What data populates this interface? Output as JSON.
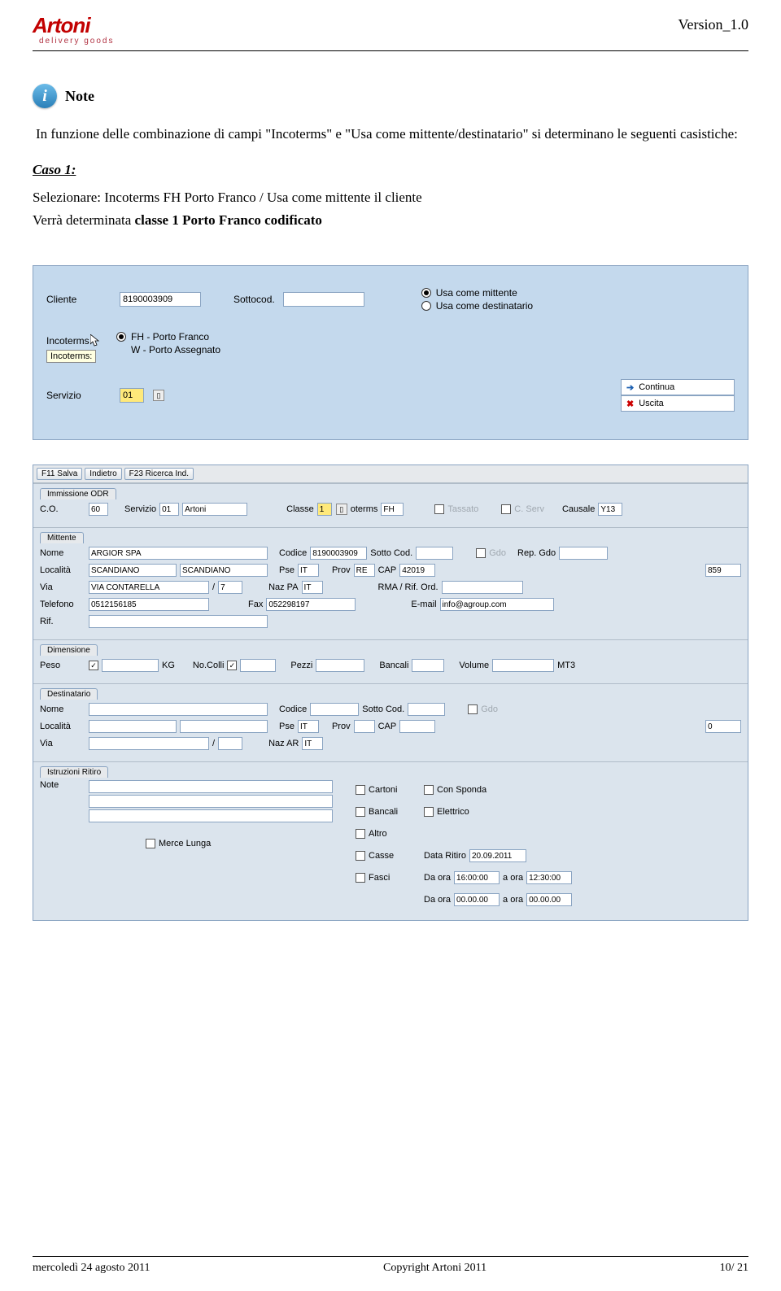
{
  "header": {
    "logo": "Artoni",
    "logo_sub": "delivery goods",
    "version": "Version_1.0"
  },
  "note": {
    "title": "Note",
    "body": "In funzione delle combinazione di campi \"Incoterms\" e \"Usa come mittente/destinatario\" si determinano le seguenti casistiche:"
  },
  "case1": {
    "label": "Caso 1:",
    "line1": "Selezionare: Incoterms FH Porto Franco /  Usa come mittente il cliente",
    "line2_prefix": "Verrà determinata ",
    "line2_bold": "classe 1 Porto Franco codificato"
  },
  "sap": {
    "cliente_label": "Cliente",
    "cliente_value": "8190003909",
    "sottocod_label": "Sottocod.",
    "sottocod_value": "",
    "usa_mittente": "Usa come mittente",
    "usa_destinatario": "Usa come destinatario",
    "incoterms_label": "Incoterms",
    "incoterms_tooltip": "Incoterms:",
    "opt_fh": "FH - Porto Franco",
    "opt_w": "W - Porto Assegnato",
    "servizio_label": "Servizio",
    "servizio_value": "01",
    "btn_continua": "Continua",
    "btn_uscita": "Uscita"
  },
  "form": {
    "toolbar": {
      "b1": "F11 Salva",
      "b2": "Indietro",
      "b3": "F23 Ricerca Ind."
    },
    "odr": {
      "tab": "Immissione ODR",
      "co_label": "C.O.",
      "co": "60",
      "serv_label": "Servizio",
      "serv": "01",
      "serv_txt": "Artoni",
      "classe_label": "Classe",
      "classe": "1",
      "oterms_label": "oterms",
      "oterms": "FH",
      "tassato": "Tassato",
      "cserv": "C. Serv",
      "causale_label": "Causale",
      "causale": "Y13"
    },
    "mittente": {
      "tab": "Mittente",
      "nome_label": "Nome",
      "nome": "ARGIOR SPA",
      "codice_label": "Codice",
      "codice": "8190003909",
      "sotto_label": "Sotto Cod.",
      "sotto": "",
      "gdo": "Gdo",
      "rep_label": "Rep. Gdo",
      "loc_label": "Località",
      "loc1": "SCANDIANO",
      "loc2": "SCANDIANO",
      "pse_label": "Pse",
      "pse": "IT",
      "prov_label": "Prov",
      "prov": "RE",
      "cap_label": "CAP",
      "cap": "42019",
      "extra": "859",
      "via_label": "Via",
      "via": "VIA CONTARELLA",
      "via_n": "7",
      "nazpa_label": "Naz PA",
      "nazpa": "IT",
      "rma_label": "RMA / Rif. Ord.",
      "rma": "",
      "tel_label": "Telefono",
      "tel": "0512156185",
      "fax_label": "Fax",
      "fax": "052298197",
      "email_label": "E-mail",
      "email": "info@agroup.com",
      "rif_label": "Rif.",
      "rif": ""
    },
    "dim": {
      "tab": "Dimensione",
      "peso_label": "Peso",
      "peso": "",
      "kg": "KG",
      "colli_label": "No.Colli",
      "colli": "",
      "pezzi_label": "Pezzi",
      "pezzi": "",
      "bancali_label": "Bancali",
      "bancali": "",
      "volume_label": "Volume",
      "volume": "",
      "mt3": "MT3"
    },
    "dest": {
      "tab": "Destinatario",
      "nome_label": "Nome",
      "codice_label": "Codice",
      "sotto_label": "Sotto Cod.",
      "gdo": "Gdo",
      "loc_label": "Località",
      "pse_label": "Pse",
      "pse": "IT",
      "prov_label": "Prov",
      "cap_label": "CAP",
      "zero": "0",
      "via_label": "Via",
      "nazar_label": "Naz AR",
      "nazar": "IT"
    },
    "istr": {
      "tab": "Istruzioni Ritiro",
      "note_label": "Note",
      "cartoni": "Cartoni",
      "con_sponda": "Con Sponda",
      "bancali": "Bancali",
      "elettrico": "Elettrico",
      "altro": "Altro",
      "casse": "Casse",
      "fasci": "Fasci",
      "data_label": "Data Ritiro",
      "data": "20.09.2011",
      "da_ora": "Da ora",
      "a_ora": "a ora",
      "t1": "16:00:00",
      "t2": "12:30:00",
      "t3": "00.00.00",
      "t4": "00.00.00",
      "merce_lunga": "Merce Lunga"
    }
  },
  "footer": {
    "date": "mercoledì 24 agosto 2011",
    "copy": "Copyright Artoni 2011",
    "page": "10/ 21"
  }
}
